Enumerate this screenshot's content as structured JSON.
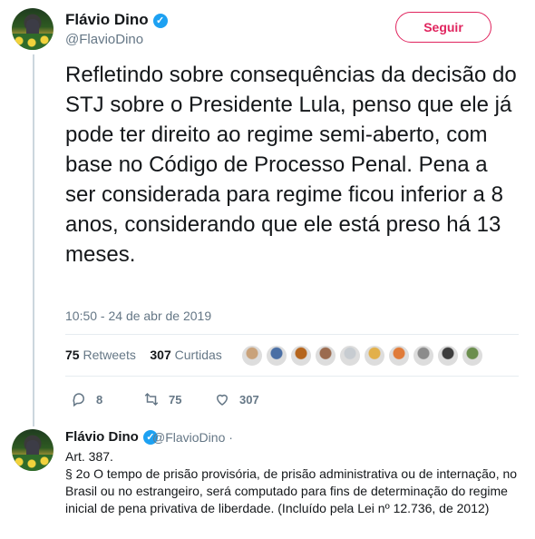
{
  "author": {
    "name": "Flávio Dino",
    "handle": "@FlavioDino"
  },
  "follow_label": "Seguir",
  "tweet": {
    "text": "Refletindo sobre consequências da decisão do STJ sobre o Presidente Lula, penso que ele já pode ter direito ao regime semi-aberto, com base no Código de Processo Penal. Pena a ser considerada para regime ficou inferior a 8 anos, considerando que ele está preso há 13 meses.",
    "timestamp": "10:50 - 24 de abr de 2019"
  },
  "stats": {
    "retweets_count": "75",
    "retweets_label": "Retweets",
    "likes_count": "307",
    "likes_label": "Curtidas"
  },
  "liker_avatar_colors": [
    "#c9a27a",
    "#4a6fa5",
    "#b5651d",
    "#9b6b4f",
    "#c7ccd1",
    "#e2b04a",
    "#e07b39",
    "#8c8c8c",
    "#3d3d3d",
    "#6b8e4e"
  ],
  "actions": {
    "replies": "8",
    "retweets": "75",
    "likes": "307"
  },
  "reply": {
    "name": "Flávio Dino",
    "handle": "@FlavioDino ·",
    "line1": "Art. 387.",
    "line2": "§ 2o O tempo de prisão provisória, de prisão administrativa ou de internação, no Brasil ou no estrangeiro, será computado para fins de determinação do regime inicial de pena privativa de liberdade. (Incluído pela Lei nº 12.736, de 2012)"
  },
  "colors": {
    "accent": "#e0245e",
    "verified": "#1da1f2",
    "muted": "#657786"
  }
}
